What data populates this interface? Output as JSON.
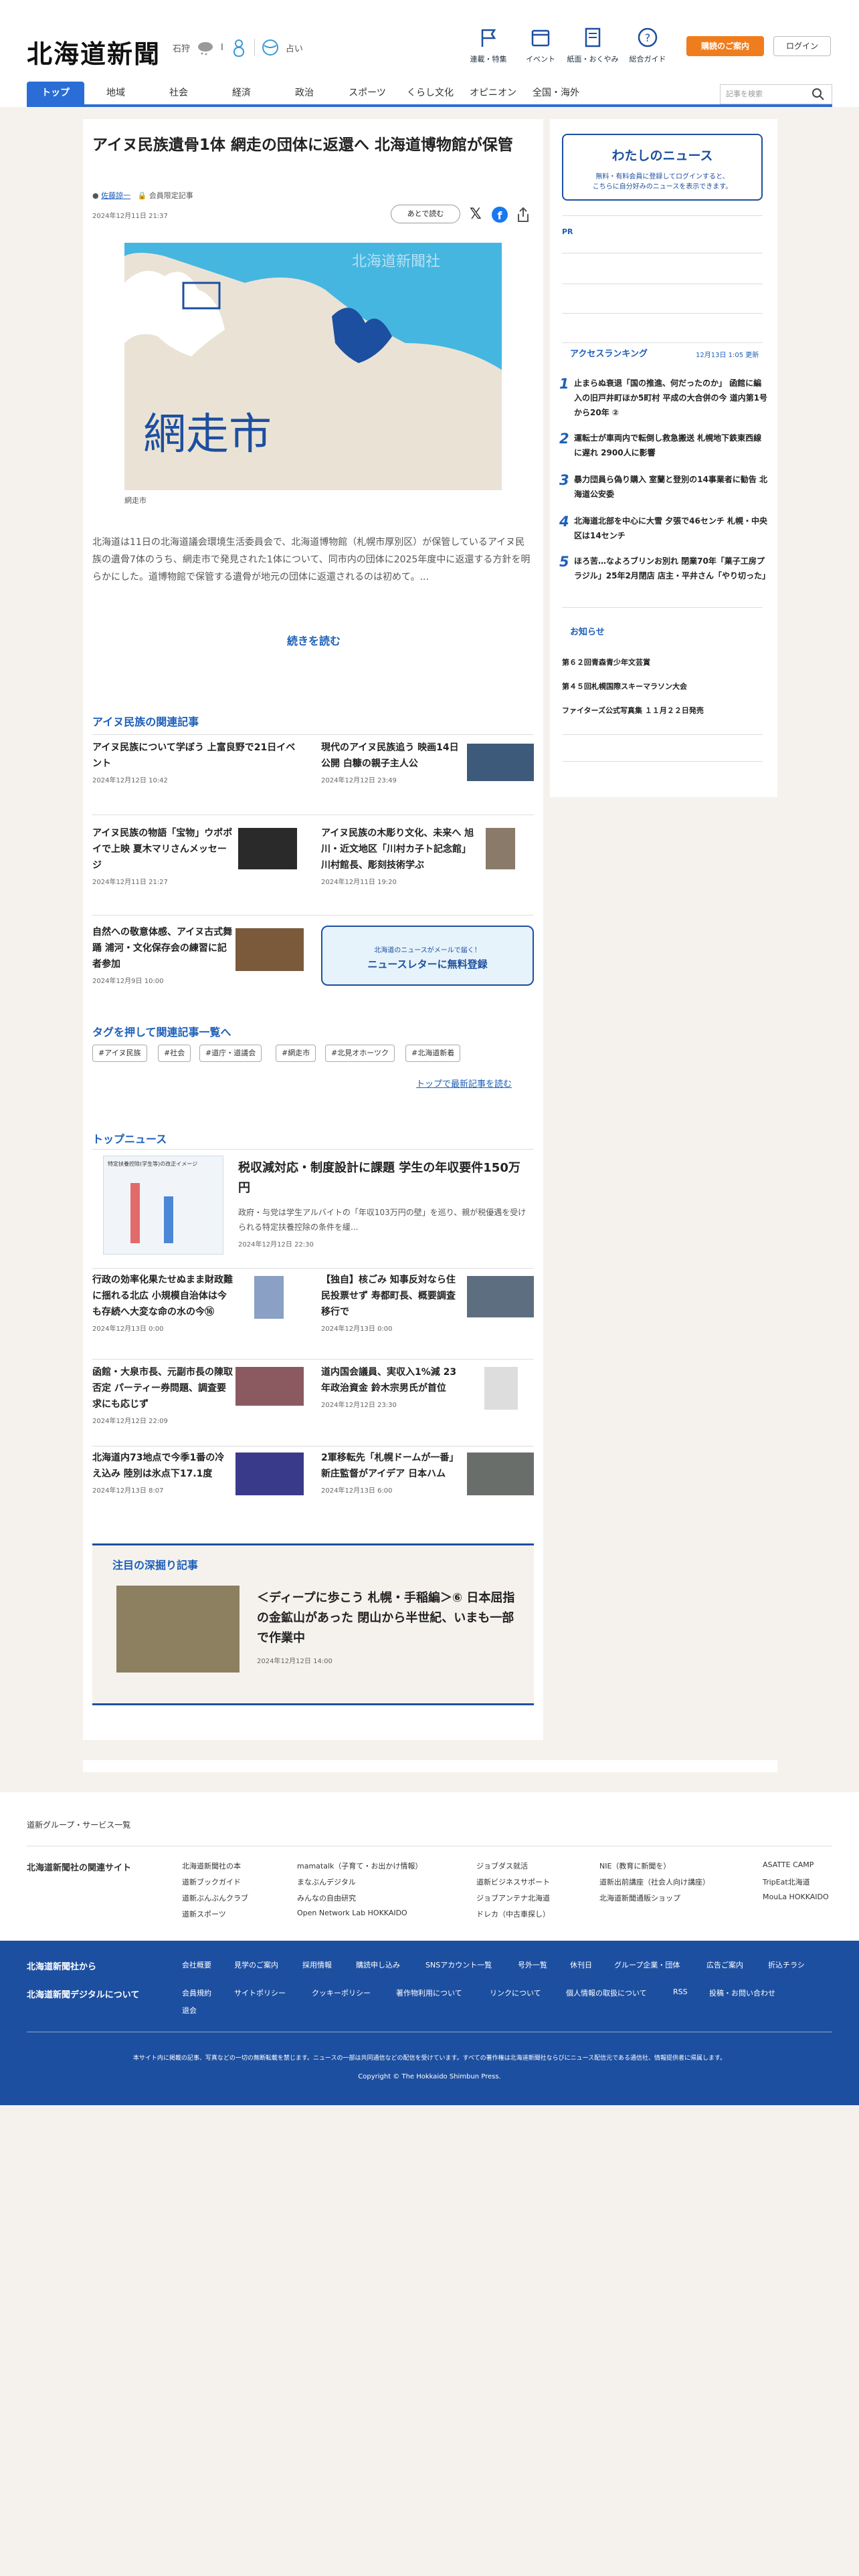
{
  "header": {
    "logo": "北海道新聞",
    "weather_city": "石狩",
    "weather_1": "I",
    "weather_2": "占い",
    "util": [
      "連載・特集",
      "イベント",
      "紙面・おくやみ",
      "総合ガイド"
    ],
    "subscribe": "購読のご案内",
    "login": "ログイン",
    "search_placeholder": "記事を検索"
  },
  "nav": [
    "トップ",
    "地域",
    "社会",
    "経済",
    "政治",
    "スポーツ",
    "くらし文化",
    "オピニオン",
    "全国・海外"
  ],
  "article": {
    "title": "アイヌ民族遺骨1体 網走の団体に返還へ 北海道博物館が保管",
    "author": "佐藤諒一",
    "members": "会員限定記事",
    "date": "2024年12月11日 21:37",
    "read_later": "あとで読む",
    "map_label": "網走市",
    "map_watermark": "北海道新聞社",
    "caption": "網走市",
    "lead": "北海道は11日の北海道議会環境生活委員会で、北海道博物館（札幌市厚別区）が保管しているアイヌ民族の遺骨7体のうち、網走市で発見された1体について、同市内の団体に2025年度中に返還する方針を明らかにした。道博物館で保管する遺骨が地元の団体に返還されるのは初めて。...",
    "continue": "続きを読む"
  },
  "related": {
    "heading": "アイヌ民族の関連記事",
    "items": [
      {
        "t": "アイヌ民族について学ぼう 上富良野で21日イベント",
        "d": "2024年12月12日 10:42"
      },
      {
        "t": "現代のアイヌ民族追う 映画14日公開 白糠の親子主人公",
        "d": "2024年12月12日 23:49"
      },
      {
        "t": "アイヌ民族の物語「宝物」ウポポイで上映 夏木マリさんメッセージ",
        "d": "2024年12月11日 21:27"
      },
      {
        "t": "アイヌ民族の木彫り文化、未来へ 旭川・近文地区「川村カ子ト記念館」川村館長、彫刻技術学ぶ",
        "d": "2024年12月11日 19:20"
      },
      {
        "t": "自然への敬意体感、アイヌ古式舞踊 浦河・文化保存会の練習に記者参加",
        "d": "2024年12月9日 10:00"
      }
    ],
    "newsletter_1": "北海道のニュースがメールで届く！",
    "newsletter_2": "ニュースレターに無料登録"
  },
  "tags": {
    "heading": "タグを押して関連記事一覧へ",
    "items": [
      "#アイヌ民族",
      "#社会",
      "#道庁・道議会",
      "#網走市",
      "#北見オホーツク",
      "#北海道新着"
    ],
    "back": "トップで最新記事を読む"
  },
  "top": {
    "heading": "トップニュース",
    "main_title": "税収減対応・制度設計に課題 学生の年収要件150万円",
    "main_lead": "政府・与党は学生アルバイトの「年収103万円の壁」を巡り、親が税優遇を受けられる特定扶養控除の条件を緩...",
    "main_date": "2024年12月12日 22:30",
    "thumb_caption": "特定扶養控除(学生等)の改正イメージ",
    "items": [
      {
        "t": "行政の効率化果たせぬまま財政難に揺れる北広 小規模自治体は今も存続へ大変な命の水の今⑯",
        "d": "2024年12月13日 0:00"
      },
      {
        "t": "【独自】核ごみ 知事反対なら住民投票せず 寿都町長、概要調査移行で",
        "d": "2024年12月13日 0:00"
      },
      {
        "t": "函館・大泉市長、元副市長の陳取否定 パーティー券問題、調査要求にも応じず",
        "d": "2024年12月12日 22:09"
      },
      {
        "t": "道内国会議員、実収入1%減 23年政治資金 鈴木宗男氏が首位",
        "d": "2024年12月12日 23:30"
      },
      {
        "t": "北海道内73地点で今季1番の冷え込み 陸別は氷点下17.1度",
        "d": "2024年12月13日 8:07"
      },
      {
        "t": "2軍移転先「札幌ドームが一番」 新庄監督がアイデア 日本ハム",
        "d": "2024年12月13日 6:00"
      }
    ]
  },
  "deep": {
    "heading": "注目の深掘り記事",
    "title": "＜ディープに歩こう 札幌・手稲編＞⑥ 日本屈指の金鉱山があった 閉山から半世紀、いまも一部で作業中",
    "date": "2024年12月12日 14:00"
  },
  "side": {
    "my_title": "わたしのニュース",
    "my_text_1": "無料・有料会員に登録してログインすると、",
    "my_text_2": "こちらに自分好みのニュースを表示できます。",
    "pr": "PR",
    "rank_heading": "アクセスランキング",
    "rank_updated": "12月13日 1:05 更新",
    "ranking": [
      "止まらぬ衰退「国の推進、何だったのか」 函館に編入の旧戸井町ほか5町村 平成の大合併の今 道内第1号から20年 ②",
      "運転士が車両内で転倒し救急搬送 札幌地下鉄東西線に遅れ 2900人に影響",
      "暴力団員ら偽り購入 室蘭と登別の14事業者に勧告 北海道公安委",
      "北海道北部を中心に大雪 夕張で46センチ 札幌・中央区は14センチ",
      "ほろ苦…なよろブリンお別れ 閉業70年「菓子工房プラジル」25年2月閉店 店主・平井さん「やり切った」"
    ],
    "notice_heading": "お知らせ",
    "notices": [
      "第６２回青森青少年文芸賞",
      "第４５回札幌国際スキーマラソン大会",
      "ファイターズ公式写真集 １１月２２日発売"
    ]
  },
  "footer": {
    "group": "道新グループ・サービス一覧",
    "related_label": "北海道新聞社の関連サイト",
    "sites": [
      "北海道新聞社の本",
      "道新ブックガイド",
      "道新ぶんぶんクラブ",
      "道新スポーツ",
      "mamatalk（子育て・お出かけ情報）",
      "まなぶんデジタル",
      "みんなの自由研究",
      "Open Network Lab HOKKAIDO",
      "ジョブダス就活",
      "道新ビジネスサポート",
      "ジョブアンテナ北海道",
      "ドレカ（中古車探し）",
      "NIE（教育に新聞を）",
      "道新出前講座（社会人向け講座）",
      "北海道新聞通販ショップ",
      "ASATTE CAMP",
      "TripEat北海道",
      "MouLa HOKKAIDO"
    ],
    "from_label": "北海道新聞社から",
    "digital_label": "北海道新聞デジタルについて",
    "from_links": [
      "会社概要",
      "見学のご案内",
      "採用情報",
      "購読申し込み",
      "SNSアカウント一覧",
      "号外一覧",
      "休刊日",
      "グループ企業・団体",
      "広告ご案内",
      "折込チラシ"
    ],
    "digital_links": [
      "会員規約",
      "サイトポリシー",
      "クッキーポリシー",
      "著作物利用について",
      "リンクについて",
      "個人情報の取扱について",
      "RSS",
      "投稿・お問い合わせ",
      "退会"
    ],
    "notice": "本サイト内に掲載の記事、写真などの一切の無断転載を禁じます。ニュースの一部は共同通信などの配信を受けています。すべての著作権は北海道新聞社ならびにニュース配信元である通信社、情報提供者に帰属します。",
    "copyright": "Copyright © The Hokkaido Shimbun Press."
  },
  "colors": {
    "accent": "#1d5fb8",
    "nav": "#2a6dd6",
    "subscribe": "#f07d1d",
    "footer": "#1d4fa0"
  }
}
